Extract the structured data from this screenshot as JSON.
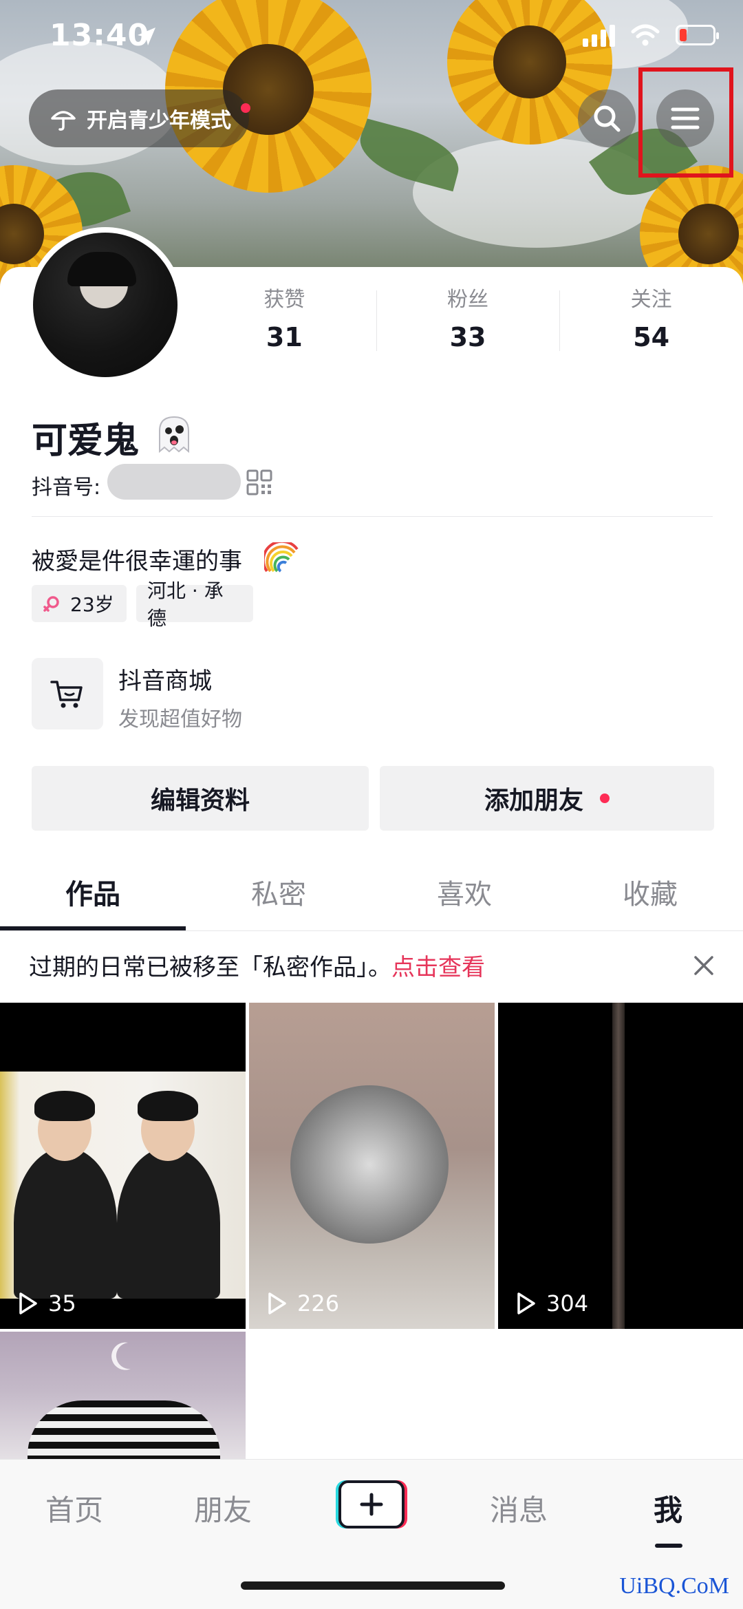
{
  "status_bar": {
    "time": "13:40"
  },
  "header": {
    "teen_mode_label": "开启青少年模式"
  },
  "profile": {
    "stats": [
      {
        "label": "获赞",
        "value": "31"
      },
      {
        "label": "粉丝",
        "value": "33"
      },
      {
        "label": "关注",
        "value": "54"
      }
    ],
    "nickname": "可爱鬼",
    "douyin_id_label": "抖音号:",
    "bio": "被愛是件很幸運的事",
    "tags": {
      "age": "23岁",
      "location": "河北 · 承德"
    }
  },
  "mall": {
    "title": "抖音商城",
    "subtitle": "发现超值好物"
  },
  "actions": {
    "edit_label": "编辑资料",
    "add_friend_label": "添加朋友"
  },
  "tabs": [
    "作品",
    "私密",
    "喜欢",
    "收藏"
  ],
  "notice": {
    "text": "过期的日常已被移至「私密作品」。",
    "link": "点击查看"
  },
  "videos": [
    {
      "plays": "35"
    },
    {
      "plays": "226"
    },
    {
      "plays": "304"
    }
  ],
  "bottom_nav": {
    "home": "首页",
    "friends": "朋友",
    "messages": "消息",
    "me": "我"
  },
  "watermark": "UiBQ.CoM",
  "colors": {
    "accent": "#fe2c55",
    "link": "#e6355a",
    "highlight_box": "#e0141d"
  }
}
